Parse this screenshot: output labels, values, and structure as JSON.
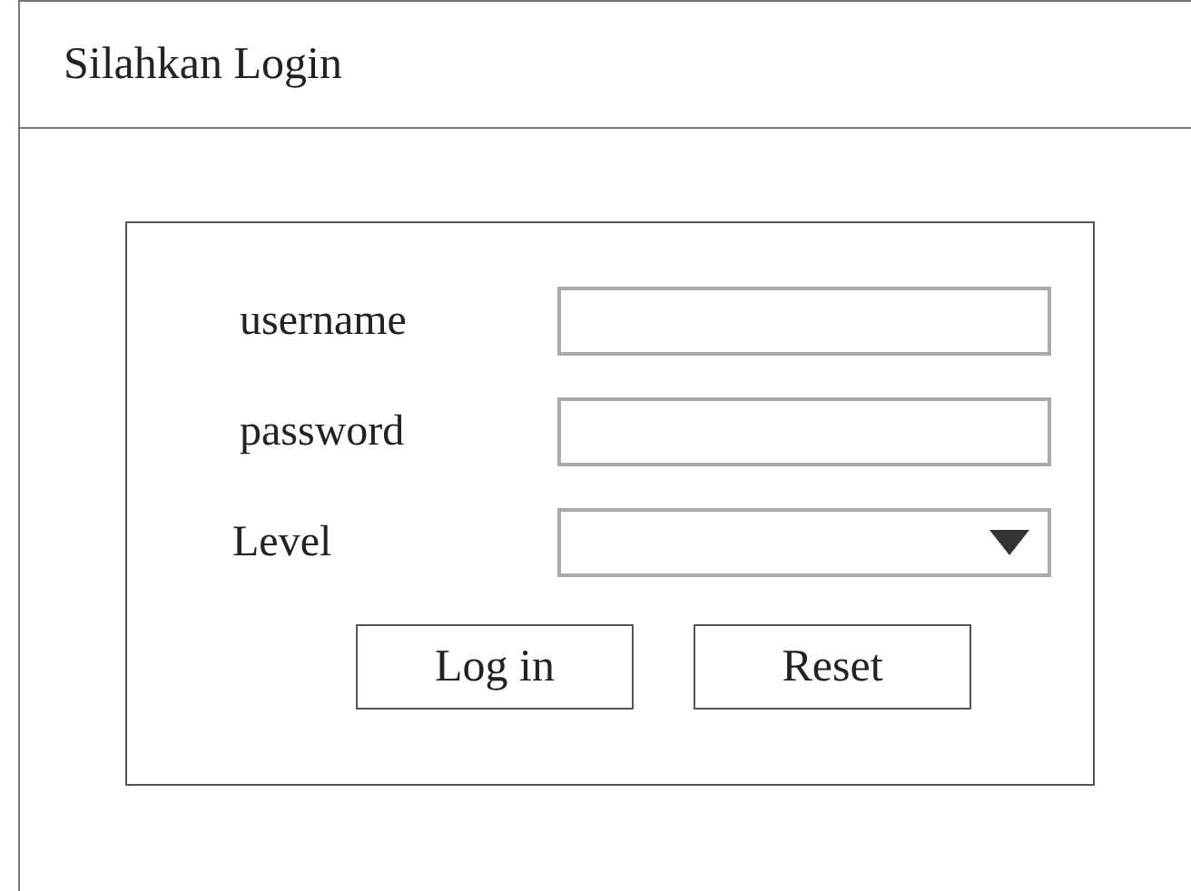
{
  "window": {
    "title": "Silahkan Login"
  },
  "form": {
    "fields": [
      {
        "label": "username",
        "kind": "text"
      },
      {
        "label": "password",
        "kind": "password"
      },
      {
        "label": "Level",
        "kind": "select"
      }
    ],
    "buttons": [
      "Log in",
      "Reset"
    ]
  }
}
